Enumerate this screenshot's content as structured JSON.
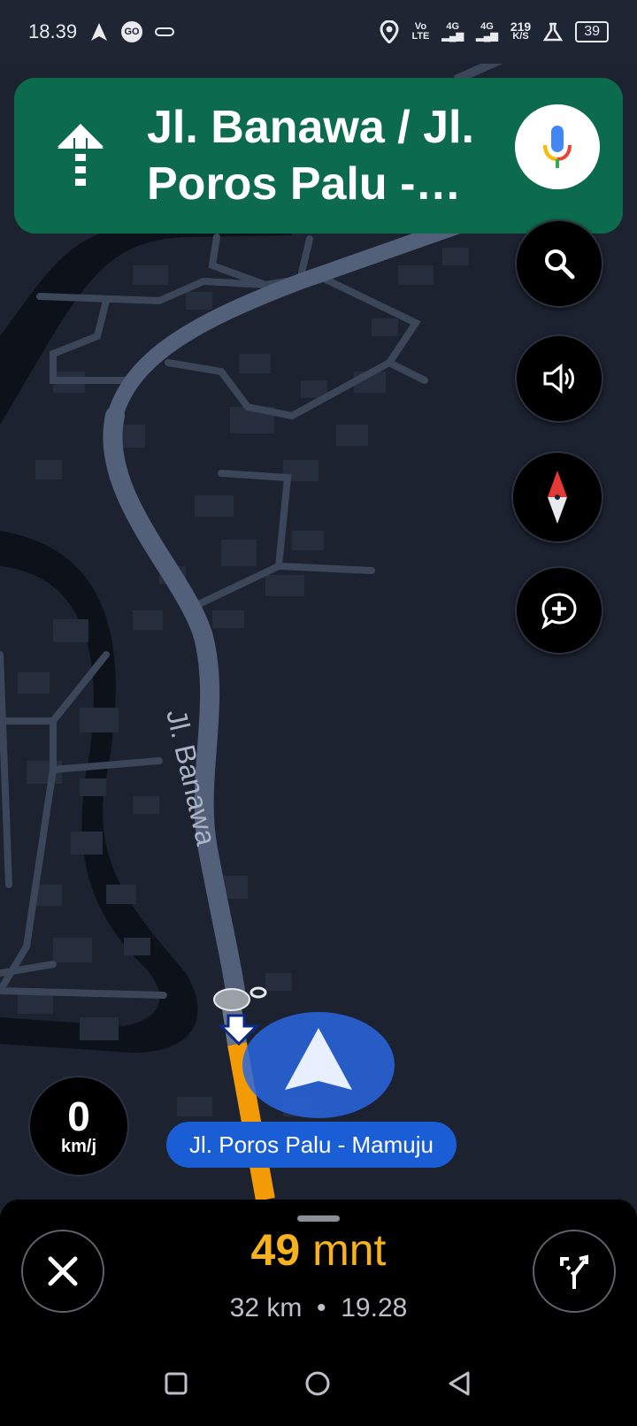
{
  "status_bar": {
    "time": "18.39",
    "go_badge": "GO",
    "volte_top": "Vo",
    "volte_bottom": "LTE",
    "sim1_net": "4G",
    "sim2_net": "4G",
    "speed_value": "219",
    "speed_unit": "K/S",
    "battery": "39"
  },
  "navigation": {
    "instruction_street": "Jl. Banawa / Jl. Poros Palu - Mamuju",
    "direction": "straight"
  },
  "map": {
    "street_label": "Jl. Banawa",
    "current_road": "Jl. Poros Palu - Mamuju"
  },
  "speedometer": {
    "value": "0",
    "unit": "km/j"
  },
  "trip": {
    "eta_number": "49",
    "eta_unit": "mnt",
    "distance": "32 km",
    "separator": "•",
    "arrival_time": "19.28"
  },
  "colors": {
    "banner": "#0b6b4c",
    "route": "#f29b06",
    "eta": "#f6b21e",
    "chip": "#1a5ed6"
  }
}
